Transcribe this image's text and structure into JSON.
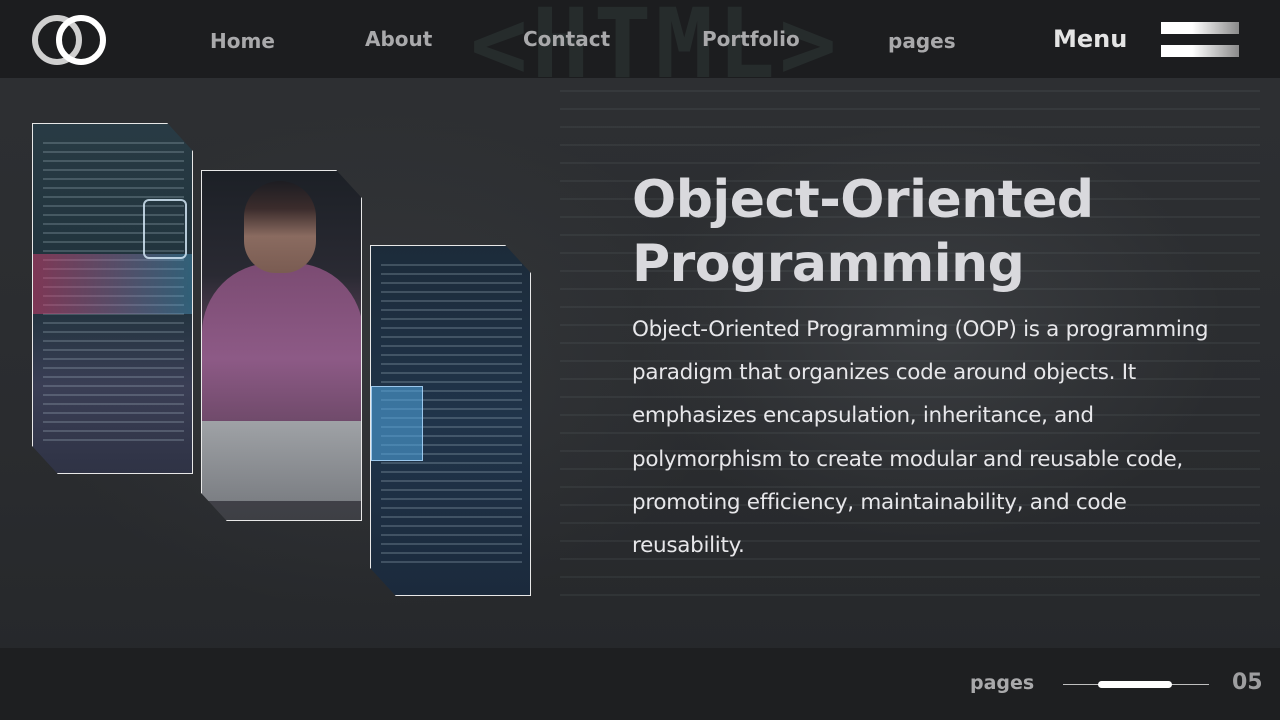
{
  "nav": {
    "items": [
      {
        "id": "home",
        "label": "Home"
      },
      {
        "id": "about",
        "label": "About"
      },
      {
        "id": "contact",
        "label": "Contact"
      },
      {
        "id": "portfolio",
        "label": "Portfolio"
      },
      {
        "id": "pages",
        "label": "pages"
      }
    ],
    "menu_label": "Menu",
    "watermark": "<HTML>"
  },
  "slide": {
    "title": "Object-Oriented Programming",
    "body": "Object-Oriented Programming (OOP) is a programming paradigm that organizes code around objects. It emphasizes encapsulation, inheritance, and polymorphism to create modular and reusable code, promoting efficiency, maintainability, and code reusability."
  },
  "footer": {
    "pages_label": "pages",
    "page_number": "05",
    "progress_start": 0.24,
    "progress_end": 0.75
  },
  "colors": {
    "topbar": "#1c1d1f",
    "background": "#2b2d30",
    "title": "#d9d9dd",
    "nav_text": "#a9a9ab"
  }
}
